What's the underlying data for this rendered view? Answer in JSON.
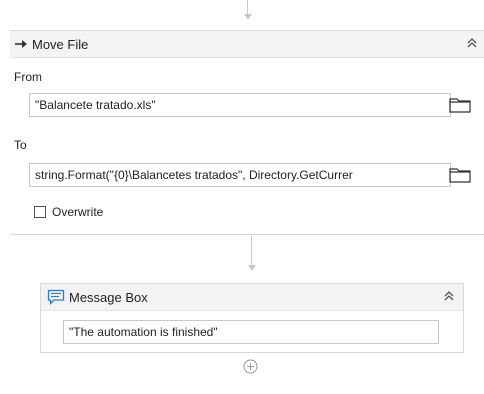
{
  "move_file": {
    "title": "Move File",
    "from_label": "From",
    "from_value": "\"Balancete tratado.xls\"",
    "to_label": "To",
    "to_value": "string.Format(\"{0}\\Balancetes tratados\", Directory.GetCurrer",
    "overwrite_label": "Overwrite",
    "overwrite_checked": false,
    "icon": "move-arrow-icon"
  },
  "message_box": {
    "title": "Message Box",
    "text_value": "\"The automation is finished\"",
    "icon": "message-icon"
  },
  "colors": {
    "header_bg": "#f3f3f3",
    "border": "#c8c8c8",
    "connector": "#c9c9c9",
    "message_icon": "#2e7bd0"
  }
}
